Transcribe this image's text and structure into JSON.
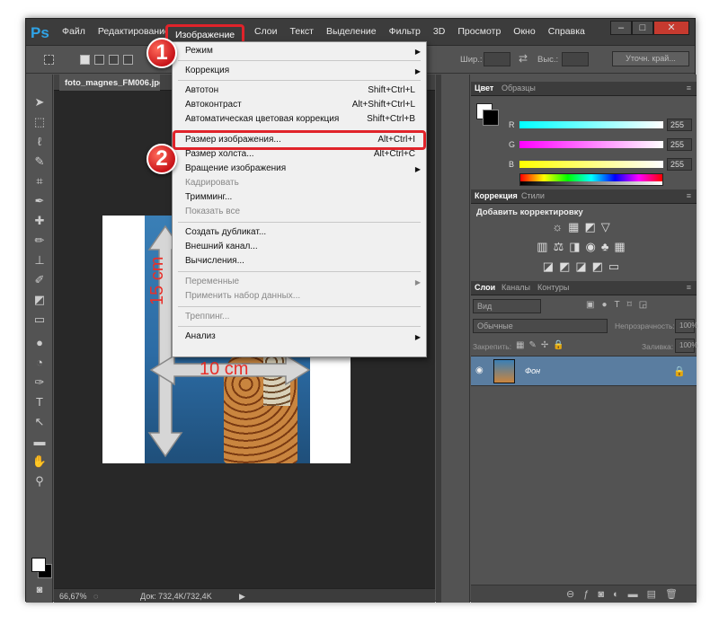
{
  "app": {
    "logo": "Ps"
  },
  "menubar": {
    "items": [
      "Файл",
      "Редактирование",
      "Изображение",
      "Слои",
      "Текст",
      "Выделение",
      "Фильтр",
      "3D",
      "Просмотр",
      "Окно",
      "Справка"
    ],
    "active_item": "Изображение"
  },
  "window_buttons": {
    "minimize": "–",
    "maximize": "□",
    "close": "✕"
  },
  "options_bar": {
    "width_label": "Шир.:",
    "height_label": "Выс.:",
    "refine_button": "Уточн. край..."
  },
  "document": {
    "tab_title": "foto_magnes_FM006.jpg @",
    "zoom": "66,67%",
    "doc_info": "Док: 732,4K/732,4K",
    "height_label": "15 cm",
    "width_label": "10 cm"
  },
  "image_menu": {
    "items": [
      {
        "label": "Режим",
        "shortcut": "",
        "submenu": true,
        "disabled": false
      },
      {
        "label": "Коррекция",
        "shortcut": "",
        "submenu": true,
        "disabled": false
      },
      {
        "label": "Автотон",
        "shortcut": "Shift+Ctrl+L",
        "submenu": false,
        "disabled": false
      },
      {
        "label": "Автоконтраст",
        "shortcut": "Alt+Shift+Ctrl+L",
        "submenu": false,
        "disabled": false
      },
      {
        "label": "Автоматическая цветовая коррекция",
        "shortcut": "Shift+Ctrl+B",
        "submenu": false,
        "disabled": false
      },
      {
        "label": "Размер изображения...",
        "shortcut": "Alt+Ctrl+I",
        "submenu": false,
        "disabled": false
      },
      {
        "label": "Размер холста...",
        "shortcut": "Alt+Ctrl+C",
        "submenu": false,
        "disabled": false
      },
      {
        "label": "Вращение изображения",
        "shortcut": "",
        "submenu": true,
        "disabled": false
      },
      {
        "label": "Кадрировать",
        "shortcut": "",
        "submenu": false,
        "disabled": true
      },
      {
        "label": "Тримминг...",
        "shortcut": "",
        "submenu": false,
        "disabled": false
      },
      {
        "label": "Показать все",
        "shortcut": "",
        "submenu": false,
        "disabled": true
      },
      {
        "label": "Создать дубликат...",
        "shortcut": "",
        "submenu": false,
        "disabled": false
      },
      {
        "label": "Внешний канал...",
        "shortcut": "",
        "submenu": false,
        "disabled": false
      },
      {
        "label": "Вычисления...",
        "shortcut": "",
        "submenu": false,
        "disabled": false
      },
      {
        "label": "Переменные",
        "shortcut": "",
        "submenu": true,
        "disabled": true
      },
      {
        "label": "Применить набор данных...",
        "shortcut": "",
        "submenu": false,
        "disabled": true
      },
      {
        "label": "Треппинг...",
        "shortcut": "",
        "submenu": false,
        "disabled": true
      },
      {
        "label": "Анализ",
        "shortcut": "",
        "submenu": true,
        "disabled": false
      }
    ]
  },
  "callouts": {
    "step1": "1",
    "step2": "2"
  },
  "color_panel": {
    "tabs": [
      "Цвет",
      "Образцы"
    ],
    "channels": [
      {
        "label": "R",
        "value": "255"
      },
      {
        "label": "G",
        "value": "255"
      },
      {
        "label": "B",
        "value": "255"
      }
    ]
  },
  "adjustments_panel": {
    "tabs": [
      "Коррекция",
      "Стили"
    ],
    "title": "Добавить корректировку"
  },
  "layers_panel": {
    "tabs": [
      "Слои",
      "Каналы",
      "Контуры"
    ],
    "kind_filter": "Вид",
    "blend_mode": "Обычные",
    "opacity_label": "Непрозрачность:",
    "opacity_value": "100%",
    "lock_label": "Закрепить:",
    "fill_label": "Заливка:",
    "fill_value": "100%",
    "layers": [
      {
        "name": "Фон",
        "locked": true,
        "visible": true
      }
    ]
  },
  "colors": {
    "accent": "#e0232a",
    "selection": "#5a7da0",
    "ps_blue": "#2fa3e6"
  }
}
